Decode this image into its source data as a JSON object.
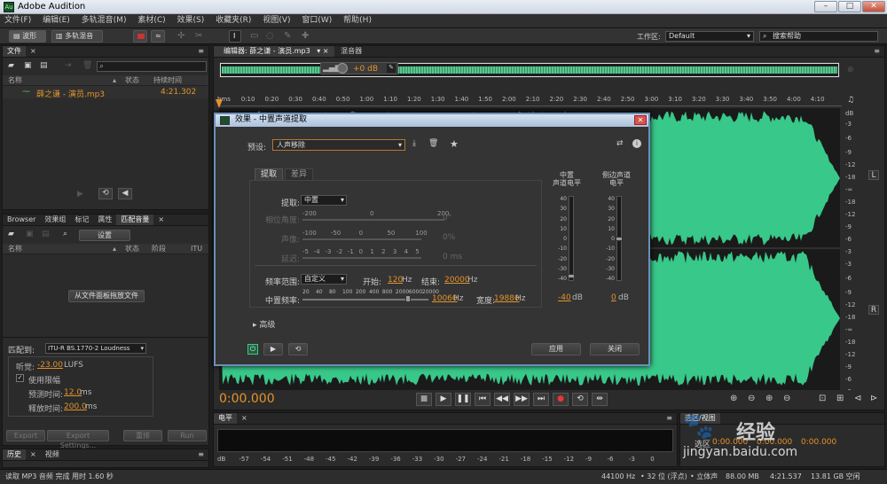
{
  "app": {
    "title": "Adobe Audition",
    "icon": "Au"
  },
  "menu": [
    "文件(F)",
    "编辑(E)",
    "多轨混音(M)",
    "素材(C)",
    "效果(S)",
    "收藏夹(R)",
    "视图(V)",
    "窗口(W)",
    "帮助(H)"
  ],
  "toolbar": {
    "waveform": "波形",
    "multitrack": "多轨混音",
    "workspace_label": "工作区:",
    "workspace_value": "Default",
    "search_placeholder": "搜索帮助"
  },
  "files_panel": {
    "tab": "文件",
    "cols": [
      "名称",
      "状态",
      "持续时间"
    ],
    "file_name": "薛之谦 - 演员.mp3",
    "file_duration": "4:21.302"
  },
  "match_panel": {
    "tabs": [
      "Browser",
      "效果组",
      "标记",
      "属性",
      "匹配音量"
    ],
    "settings_btn": "设置",
    "cols": [
      "名称",
      "状态",
      "阶段",
      "ITU"
    ],
    "drag_btn": "从文件面板拖放文件",
    "match_to_label": "匹配到:",
    "match_to_value": "ITU-R BS.1770-2 Loudness",
    "loudness_label": "听觉:",
    "loudness_value": "-23.00",
    "loudness_unit": "LUFS",
    "limit_label": "使用限幅",
    "lookahead_label": "预测时间:",
    "lookahead_value": "12.0",
    "lookahead_unit": "ms",
    "release_label": "释放时间:",
    "release_value": "200.0",
    "release_unit": "ms",
    "export_btn": "Export",
    "export_settings_btn": "Export Settings...",
    "clear_btn": "重排",
    "run_btn": "Run"
  },
  "history": {
    "tabs": [
      "历史",
      "视频"
    ]
  },
  "editor": {
    "tab": "编辑器: 薛之谦 - 演员.mp3",
    "mixer_tab": "混音器",
    "gain": "+0 dB",
    "ruler": [
      "hms",
      "0:10",
      "0:20",
      "0:30",
      "0:40",
      "0:50",
      "1:00",
      "1:10",
      "1:20",
      "1:30",
      "1:40",
      "1:50",
      "2:00",
      "2:10",
      "2:20",
      "2:30",
      "2:40",
      "2:50",
      "3:00",
      "3:10",
      "3:20",
      "3:30",
      "3:40",
      "3:50",
      "4:00",
      "4:10"
    ],
    "db_scale": [
      "dB",
      "-3",
      "-6",
      "-9",
      "-12",
      "-18",
      "-∞",
      "-18",
      "-12",
      "-9",
      "-6",
      "-3"
    ],
    "ch_l": "L",
    "ch_r": "R",
    "time": "0:00.000"
  },
  "dialog": {
    "title": "效果 - 中置声道提取",
    "preset_label": "预设:",
    "preset_value": "人声移除",
    "tabs": [
      "提取",
      "差异"
    ],
    "extract_label": "提取:",
    "extract_value": "中置",
    "phase_label": "相位角度:",
    "phase_scale": [
      "-200",
      "0",
      "200"
    ],
    "phase_value": "0°",
    "pan_label": "声像:",
    "pan_scale": [
      "-100",
      "-50",
      "0",
      "50",
      "100"
    ],
    "pan_value": "0%",
    "delay_label": "延迟:",
    "delay_scale": [
      "-5",
      "-4",
      "-3",
      "-2",
      "-1",
      "0",
      "1",
      "2",
      "3",
      "4",
      "5"
    ],
    "delay_value": "0 ms",
    "freq_label": "频率范围:",
    "freq_value": "自定义",
    "start_label": "开始:",
    "start_value": "120",
    "start_unit": "Hz",
    "end_label": "结束:",
    "end_value": "20000",
    "end_unit": "Hz",
    "center_label": "中置频率:",
    "center_scale": [
      "20",
      "40",
      "80",
      "100",
      "200",
      "400",
      "800",
      "2000",
      "6000",
      "20000"
    ],
    "center_value": "10060",
    "center_unit": "Hz",
    "width_label": "宽度:",
    "width_value": "19880",
    "width_unit": "Hz",
    "advanced": "高级",
    "meter1_title": "中置\n声道电平",
    "meter2_title": "侧边声道\n电平",
    "meter_scale": [
      "40",
      "30",
      "20",
      "10",
      "0",
      "-10",
      "-20",
      "-30",
      "-40"
    ],
    "meter1_value": "-40",
    "meter2_value": "0",
    "db": "dB",
    "apply_btn": "应用",
    "close_btn": "关闭"
  },
  "levels": {
    "tab": "电平",
    "scale": [
      "dB",
      "-57",
      "-54",
      "-51",
      "-48",
      "-45",
      "-42",
      "-39",
      "-36",
      "-33",
      "-30",
      "-27",
      "-24",
      "-21",
      "-18",
      "-15",
      "-12",
      "-9",
      "-6",
      "-3",
      "0"
    ]
  },
  "selection": {
    "tab": "选区/视图",
    "row_label": "选区",
    "v1": "0:00.000",
    "v2": "0:00.000",
    "v3": "0:00.000"
  },
  "status": {
    "left": "读取 MP3 音频 完成 用时 1.60 秒",
    "rate": "44100 Hz",
    "bits": "32 位 (浮点)",
    "channels": "立体声",
    "size": "88.00 MB",
    "duration": "4:21.537",
    "free": "13.81 GB 空闲"
  },
  "watermark": {
    "text": "经验",
    "url": "jingyan.baidu.com"
  }
}
